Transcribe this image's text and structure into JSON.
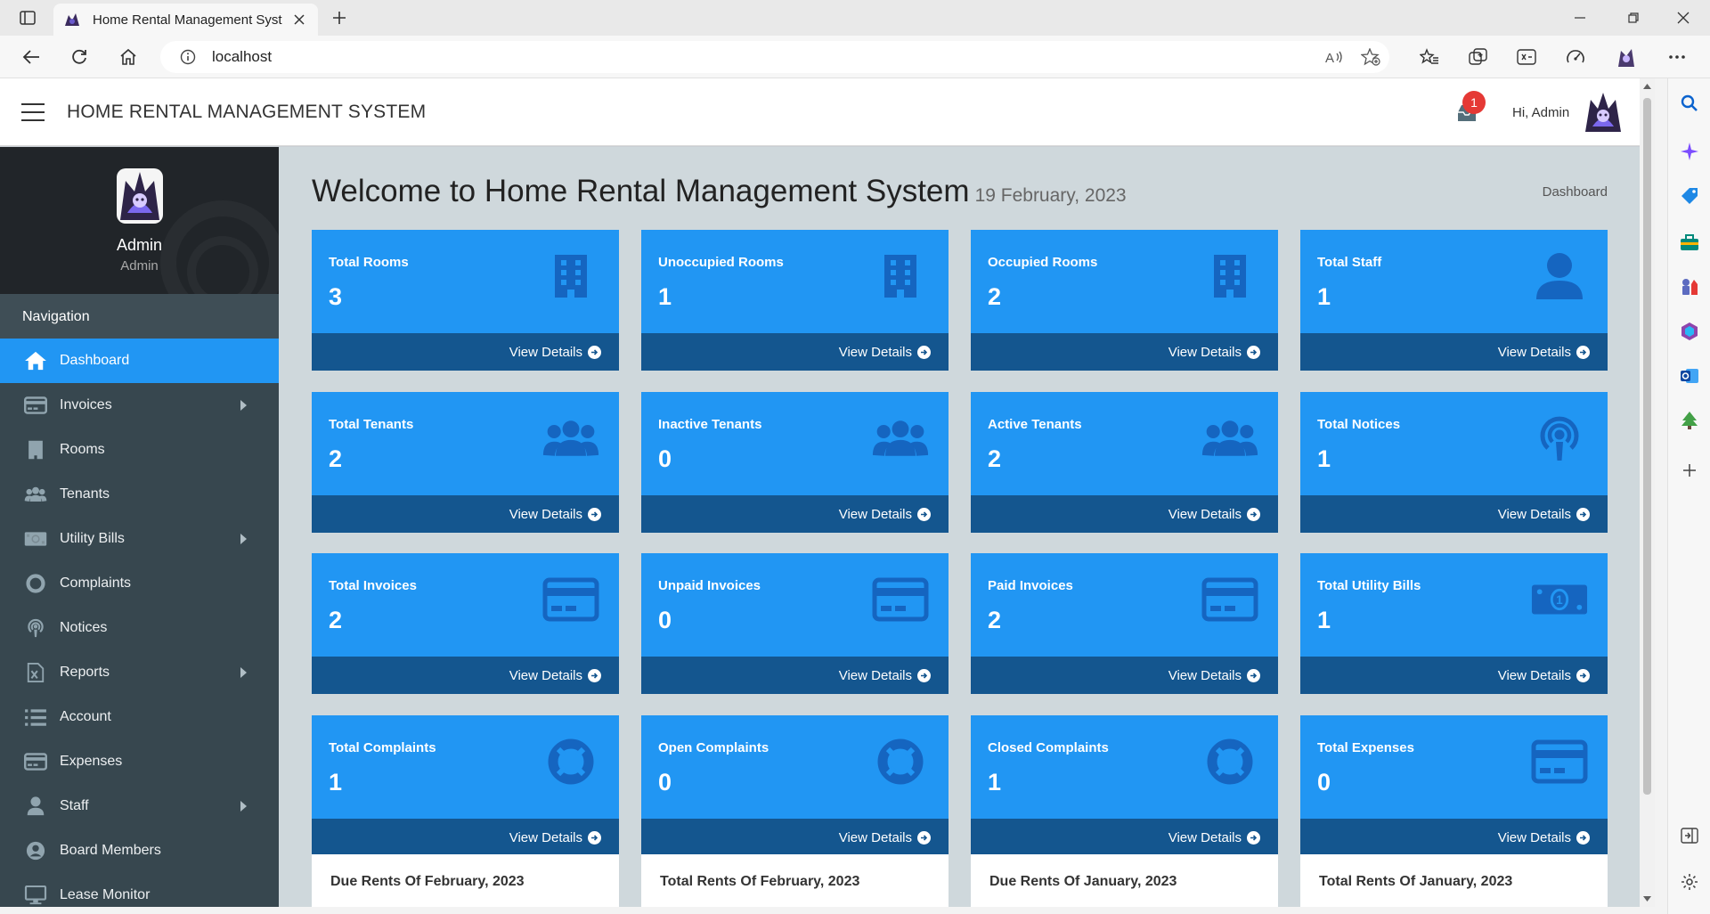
{
  "browser": {
    "tab_title": "Home Rental Management System",
    "url": "localhost",
    "colors": {
      "chrome": "#e9e9e9",
      "toolbar": "#f7f7f7"
    }
  },
  "header": {
    "brand": "HOME RENTAL MANAGEMENT SYSTEM",
    "notification_count": "1",
    "greeting": "Hi, Admin"
  },
  "profile": {
    "name": "Admin",
    "role": "Admin"
  },
  "sidebar": {
    "heading": "Navigation",
    "items": [
      {
        "label": "Dashboard",
        "icon": "home-icon",
        "active": true,
        "submenu": false
      },
      {
        "label": "Invoices",
        "icon": "credit-card-icon",
        "active": false,
        "submenu": true
      },
      {
        "label": "Rooms",
        "icon": "building-icon",
        "active": false,
        "submenu": false
      },
      {
        "label": "Tenants",
        "icon": "users-icon",
        "active": false,
        "submenu": false
      },
      {
        "label": "Utility Bills",
        "icon": "money-bill-icon",
        "active": false,
        "submenu": true
      },
      {
        "label": "Complaints",
        "icon": "life-ring-icon",
        "active": false,
        "submenu": false
      },
      {
        "label": "Notices",
        "icon": "podcast-icon",
        "active": false,
        "submenu": false
      },
      {
        "label": "Reports",
        "icon": "file-excel-icon",
        "active": false,
        "submenu": true
      },
      {
        "label": "Account",
        "icon": "list-icon",
        "active": false,
        "submenu": false
      },
      {
        "label": "Expenses",
        "icon": "credit-card-icon",
        "active": false,
        "submenu": false
      },
      {
        "label": "Staff",
        "icon": "user-icon",
        "active": false,
        "submenu": true
      },
      {
        "label": "Board Members",
        "icon": "user-circle-icon",
        "active": false,
        "submenu": false
      },
      {
        "label": "Lease Monitor",
        "icon": "desktop-icon",
        "active": false,
        "submenu": false
      }
    ]
  },
  "main": {
    "title": "Welcome to Home Rental Management System",
    "date": "19 February, 2023",
    "breadcrumb": "Dashboard",
    "view_details": "View Details",
    "cards": [
      {
        "label": "Total Rooms",
        "value": "3",
        "icon": "building-icon"
      },
      {
        "label": "Unoccupied Rooms",
        "value": "1",
        "icon": "building-icon"
      },
      {
        "label": "Occupied Rooms",
        "value": "2",
        "icon": "building-icon"
      },
      {
        "label": "Total Staff",
        "value": "1",
        "icon": "user-icon"
      },
      {
        "label": "Total Tenants",
        "value": "2",
        "icon": "users-icon"
      },
      {
        "label": "Inactive Tenants",
        "value": "0",
        "icon": "users-icon"
      },
      {
        "label": "Active Tenants",
        "value": "2",
        "icon": "users-icon"
      },
      {
        "label": "Total Notices",
        "value": "1",
        "icon": "podcast-icon"
      },
      {
        "label": "Total Invoices",
        "value": "2",
        "icon": "credit-card-icon"
      },
      {
        "label": "Unpaid Invoices",
        "value": "0",
        "icon": "credit-card-icon"
      },
      {
        "label": "Paid Invoices",
        "value": "2",
        "icon": "credit-card-icon"
      },
      {
        "label": "Total Utility Bills",
        "value": "1",
        "icon": "money-bill-icon"
      },
      {
        "label": "Total Complaints",
        "value": "1",
        "icon": "life-ring-icon"
      },
      {
        "label": "Open Complaints",
        "value": "0",
        "icon": "life-ring-icon"
      },
      {
        "label": "Closed Complaints",
        "value": "1",
        "icon": "life-ring-icon"
      },
      {
        "label": "Total Expenses",
        "value": "0",
        "icon": "credit-card-icon"
      }
    ],
    "panels": [
      "Due Rents Of February, 2023",
      "Total Rents Of February, 2023",
      "Due Rents Of January, 2023",
      "Total Rents Of January, 2023"
    ],
    "colors": {
      "card": "#2196f3",
      "card_footer": "#14568f",
      "icon_tint": "#1565c0",
      "active_nav": "#2196f3",
      "sidebar": "#37474f"
    }
  }
}
